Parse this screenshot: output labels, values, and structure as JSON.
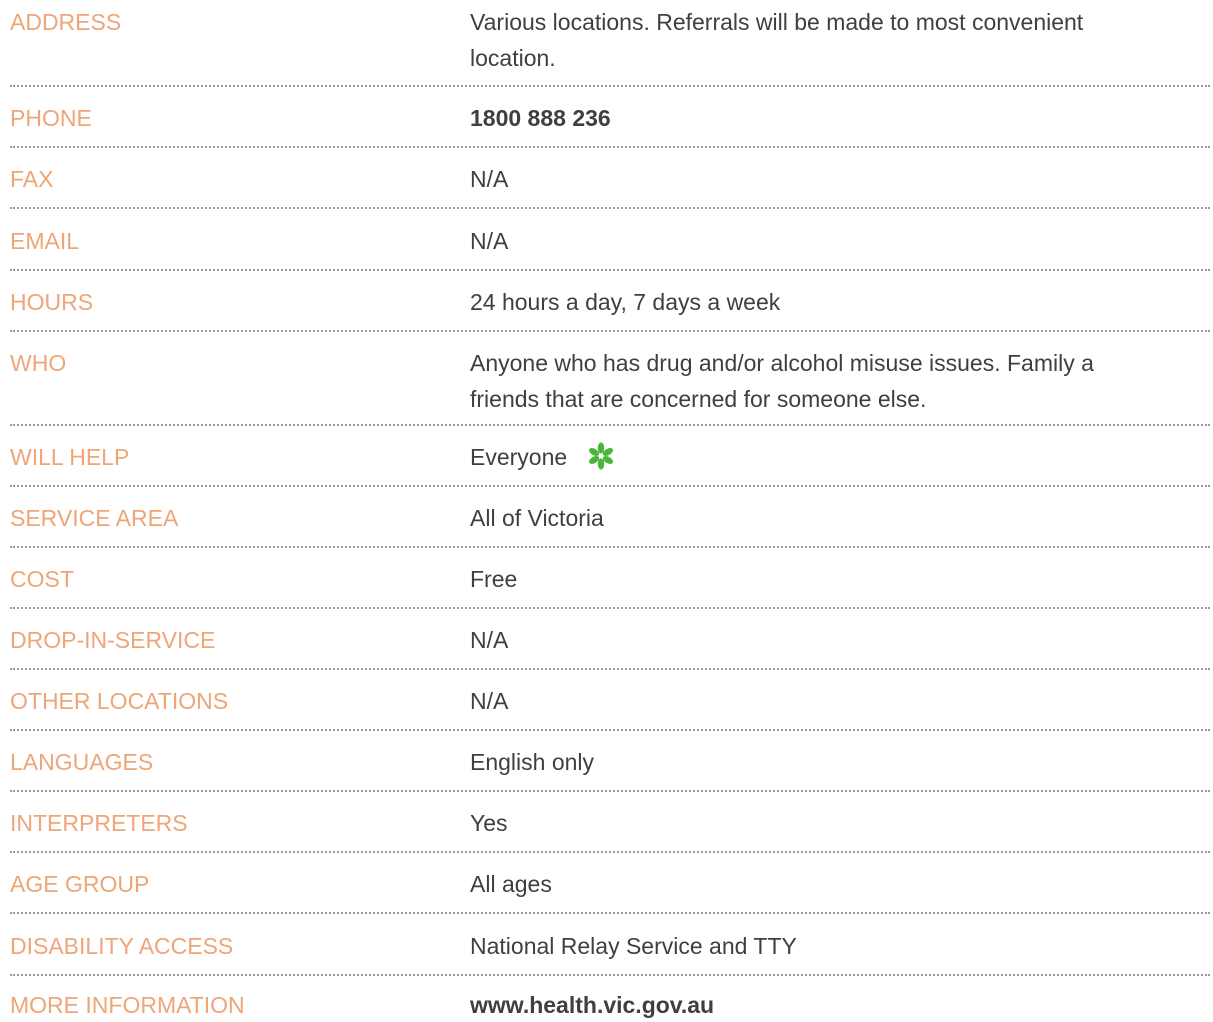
{
  "rows": [
    {
      "label": "ADDRESS",
      "value": "Various locations. Referrals will be made to most convenient",
      "value2": "location."
    },
    {
      "label": "PHONE",
      "value": "1800 888 236"
    },
    {
      "label": "FAX",
      "value": "N/A"
    },
    {
      "label": "EMAIL",
      "value": "N/A"
    },
    {
      "label": "HOURS",
      "value": "24 hours a day, 7 days a week"
    },
    {
      "label": "WHO",
      "value": "Anyone who has drug and/or alcohol misuse issues. Family a",
      "value2": "friends that are concerned for someone else."
    },
    {
      "label": "WILL HELP",
      "value": "Everyone",
      "icon": "flower-icon"
    },
    {
      "label": "SERVICE AREA",
      "value": "All of Victoria"
    },
    {
      "label": "COST",
      "value": "Free"
    },
    {
      "label": "DROP-IN-SERVICE",
      "value": "N/A"
    },
    {
      "label": "OTHER LOCATIONS",
      "value": "N/A"
    },
    {
      "label": "LANGUAGES",
      "value": "English only"
    },
    {
      "label": "INTERPRETERS",
      "value": "Yes"
    },
    {
      "label": "AGE GROUP",
      "value": "All ages"
    },
    {
      "label": "DISABILITY ACCESS",
      "value": "National Relay Service and TTY"
    },
    {
      "label": "MORE INFORMATION",
      "value": "www.health.vic.gov.au"
    }
  ],
  "colors": {
    "label": "#eea578",
    "value": "#3f3f3f",
    "divider": "#9a9a9a",
    "icon": "#4bb53a"
  }
}
